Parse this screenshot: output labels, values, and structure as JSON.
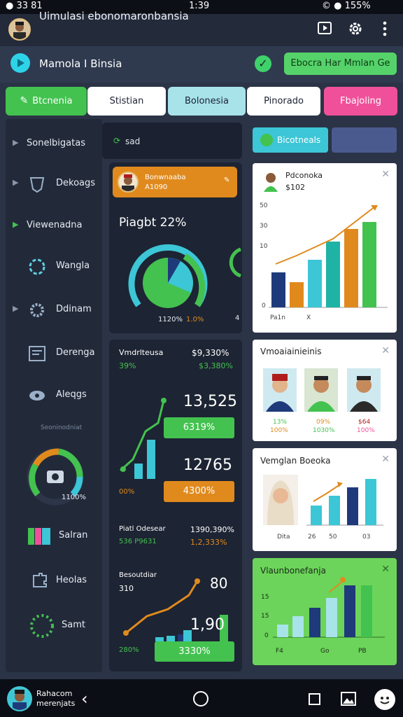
{
  "status_bar": {
    "left": "● 33 81",
    "time": "1:39",
    "right": "© ● 155%"
  },
  "app": {
    "title": "Uimulasi ebonomaronbansia"
  },
  "brand": {
    "title": "Mamola I Binsia",
    "cta": "Ebocra Har Mmlan Ge"
  },
  "tabs": [
    {
      "label": "Btcnenia",
      "bg": "#43c24f",
      "fg": "#ffffff"
    },
    {
      "label": "Stistian",
      "bg": "#ffffff",
      "fg": "#1c2233"
    },
    {
      "label": "Bolonesia",
      "bg": "#a8e3ea",
      "fg": "#1c2233"
    },
    {
      "label": "Pinorado",
      "bg": "#ffffff",
      "fg": "#1c2233"
    },
    {
      "label": "Fbajoling",
      "bg": "#f0509a",
      "fg": "#ffffff"
    }
  ],
  "sidebar": {
    "items": [
      {
        "label": "Sonelbigatas"
      },
      {
        "label": "Dekoags"
      },
      {
        "label": "Viewenadna"
      },
      {
        "label": "Wangla"
      },
      {
        "label": "Ddinam"
      },
      {
        "label": "Derenga"
      },
      {
        "label": "Aleqgs"
      }
    ],
    "gauge_caption": "Seoninodniat",
    "gauge_value": "1100%",
    "items_bottom": [
      {
        "label": "Salran"
      },
      {
        "label": "Heolas"
      },
      {
        "label": "Samt"
      }
    ]
  },
  "middle": {
    "header_label": "sad",
    "profile_name": "Bonwnaaba",
    "profile_sub": "A1090",
    "headline": "Piagbt 22%",
    "donut_left": "1120%",
    "donut_right": "1.0%",
    "donut_side": "4",
    "stats_card": {
      "title": "Vmdrlteusa",
      "title_value": "$9,330%",
      "sub_left": "39%",
      "sub_right": "$3,380%",
      "big1": "13,525",
      "badge1": "6319%",
      "big2": "12765",
      "left_small": "00%",
      "badge2": "4300%",
      "row_title": "Piatl Odesear",
      "row_title_value": "1390,390%",
      "row_sub_left": "536 P9631",
      "row_sub_right": "1,2,333%",
      "bottom_title": "Besoutdiar",
      "bottom_sub": "310",
      "bottom_big": "80",
      "bottom_big2": "1,90",
      "bottom_left": "280%",
      "badge3": "3330%"
    }
  },
  "right": {
    "tab1": "Bicotneals",
    "card1": {
      "title": "Pdconoka",
      "value": "$102",
      "yticks": [
        "50",
        "30",
        "10",
        "0"
      ],
      "xticks": [
        "Pa1n",
        "X"
      ]
    },
    "card2": {
      "title": "Vmoaiainieinis",
      "people": [
        {
          "v1": "13%",
          "v2": "100%"
        },
        {
          "v1": "09%",
          "v2": "1030%"
        },
        {
          "v1": "$64",
          "v2": "100%"
        }
      ]
    },
    "card3": {
      "title": "Vemglan Boeoka",
      "xticks": [
        "Dita",
        "26",
        "50",
        "03"
      ]
    },
    "card4": {
      "title": "Vlaunbonefanja",
      "yticks": [
        "15",
        "15",
        "0"
      ],
      "xticks": [
        "F4",
        "Go",
        "PB"
      ]
    }
  },
  "colors": {
    "green": "#43c24f",
    "orange": "#e08a1e",
    "teal": "#3cc6d6",
    "navy": "#1e3a7a",
    "pink": "#f0509a"
  }
}
